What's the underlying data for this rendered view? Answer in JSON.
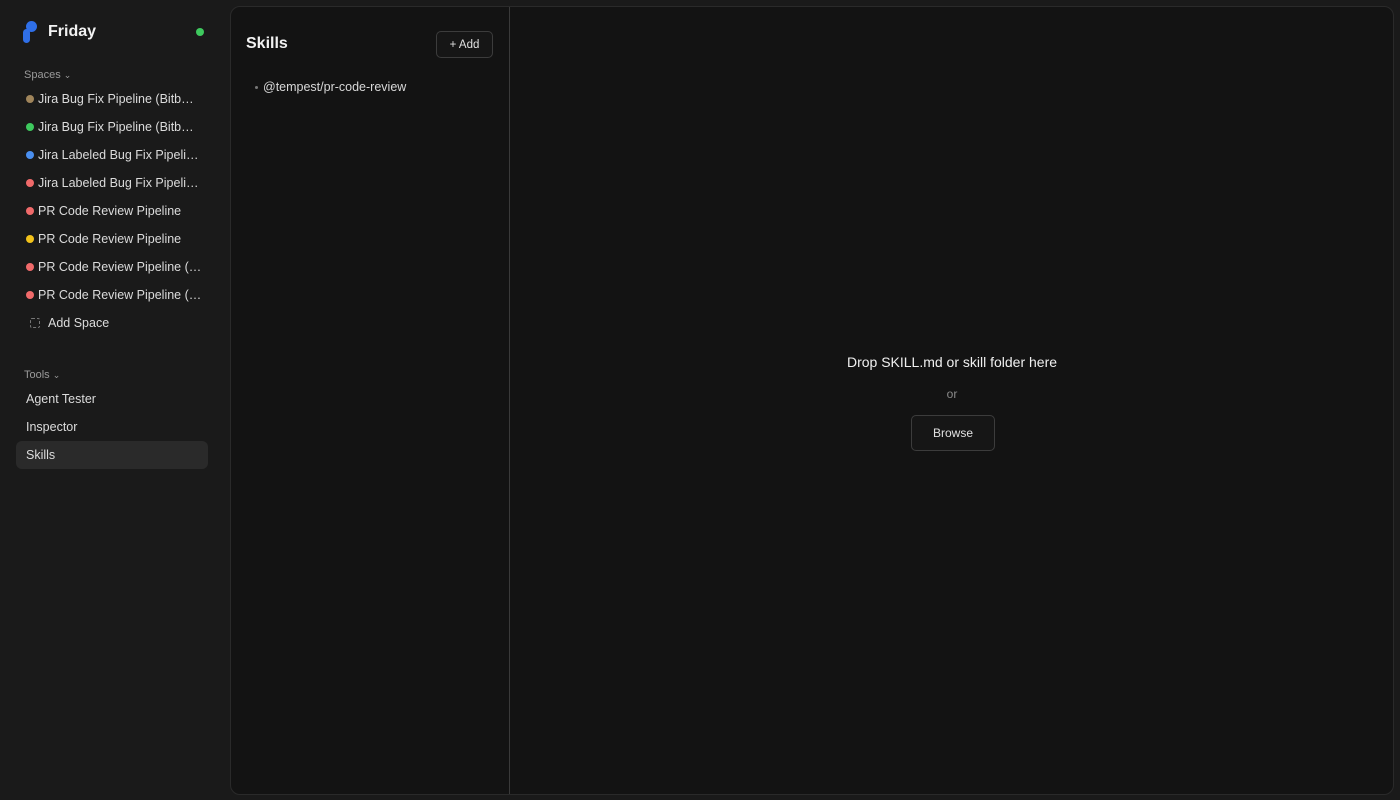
{
  "app": {
    "name": "Friday",
    "status_color": "#3ec95e",
    "accent": "#2f6fe8"
  },
  "sidebar": {
    "spaces_header": "Spaces",
    "spaces": [
      {
        "label": "Jira Bug Fix Pipeline (Bitb…",
        "color": "#a0855b"
      },
      {
        "label": "Jira Bug Fix Pipeline (Bitb…",
        "color": "#3ec95e"
      },
      {
        "label": "Jira Labeled Bug Fix Pipeli…",
        "color": "#4a8ff0"
      },
      {
        "label": "Jira Labeled Bug Fix Pipeli…",
        "color": "#f06a6a"
      },
      {
        "label": "PR Code Review Pipeline",
        "color": "#f06a6a"
      },
      {
        "label": "PR Code Review Pipeline",
        "color": "#f2c21a"
      },
      {
        "label": "PR Code Review Pipeline (…",
        "color": "#f06a6a"
      },
      {
        "label": "PR Code Review Pipeline (…",
        "color": "#f06a6a"
      }
    ],
    "add_space_label": "Add Space",
    "tools_header": "Tools",
    "tools": [
      {
        "label": "Agent Tester",
        "active": false
      },
      {
        "label": "Inspector",
        "active": false
      },
      {
        "label": "Skills",
        "active": true
      }
    ]
  },
  "skills_pane": {
    "title": "Skills",
    "add_label": "+ Add",
    "items": [
      "@tempest/pr-code-review"
    ]
  },
  "drop_zone": {
    "title": "Drop SKILL.md or skill folder here",
    "or_label": "or",
    "browse_label": "Browse"
  }
}
